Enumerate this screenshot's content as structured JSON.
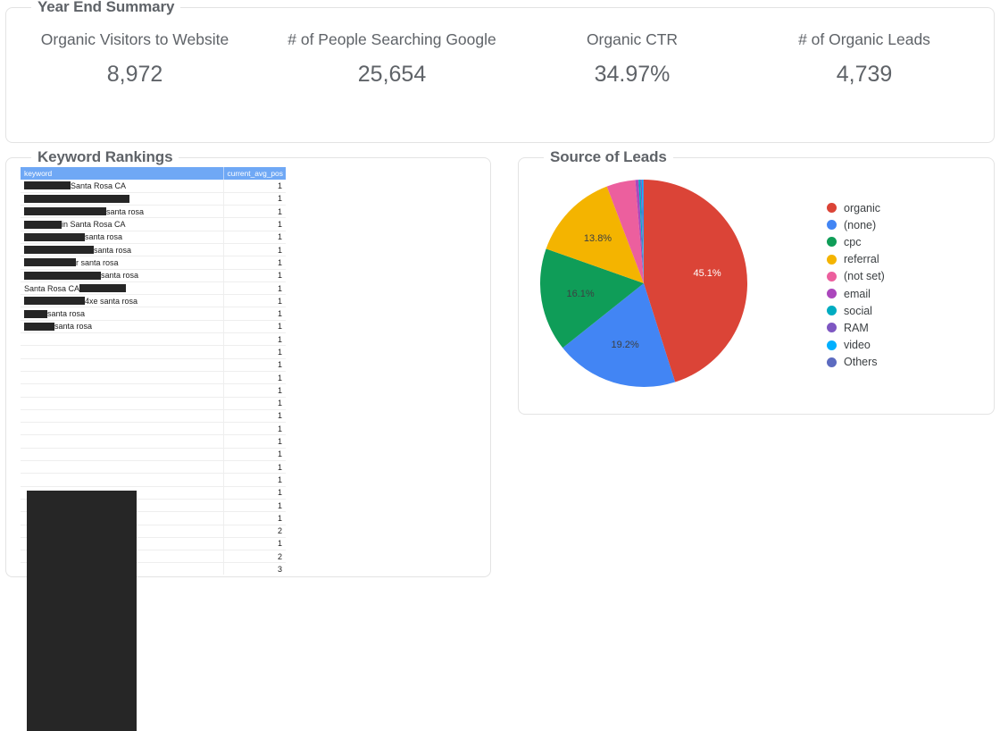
{
  "summary": {
    "title": "Year End Summary",
    "scorecards": [
      {
        "label": "Organic Visitors to Website",
        "value": "8,972"
      },
      {
        "label": "# of People Searching Google",
        "value": "25,654"
      },
      {
        "label": "Organic CTR",
        "value": "34.97%"
      },
      {
        "label": "# of Organic Leads",
        "value": "4,739"
      }
    ]
  },
  "keyword_rankings": {
    "title": "Keyword Rankings",
    "columns": [
      "keyword",
      "current_avg_pos"
    ],
    "rows": [
      {
        "keyword": "Santa Rosa CA",
        "redact_before": 52,
        "redact_after": 0,
        "current_avg_pos": "1"
      },
      {
        "keyword": "",
        "redact_before": 118,
        "redact_after": 0,
        "current_avg_pos": "1"
      },
      {
        "keyword": "santa rosa",
        "redact_before": 92,
        "redact_after": 0,
        "current_avg_pos": "1"
      },
      {
        "keyword": "in Santa Rosa CA",
        "redact_before": 42,
        "redact_after": 0,
        "current_avg_pos": "1"
      },
      {
        "keyword": " santa rosa",
        "redact_before": 68,
        "redact_after": 0,
        "current_avg_pos": "1"
      },
      {
        "keyword": " santa rosa",
        "redact_before": 78,
        "redact_after": 0,
        "current_avg_pos": "1"
      },
      {
        "keyword": "r santa rosa",
        "redact_before": 58,
        "redact_after": 0,
        "current_avg_pos": "1"
      },
      {
        "keyword": " santa rosa",
        "redact_before": 86,
        "redact_after": 0,
        "current_avg_pos": "1"
      },
      {
        "keyword": "Santa Rosa CA ",
        "redact_before": 0,
        "redact_after": 52,
        "current_avg_pos": "1"
      },
      {
        "keyword": "4xe santa rosa",
        "redact_before": 68,
        "redact_after": 0,
        "current_avg_pos": "1"
      },
      {
        "keyword": " santa rosa",
        "redact_before": 26,
        "redact_after": 0,
        "current_avg_pos": "1"
      },
      {
        "keyword": " santa rosa",
        "redact_before": 34,
        "redact_after": 0,
        "current_avg_pos": "1"
      },
      {
        "keyword": "",
        "redact_before": 0,
        "redact_after": 0,
        "current_avg_pos": "1"
      },
      {
        "keyword": "",
        "redact_before": 0,
        "redact_after": 0,
        "current_avg_pos": "1"
      },
      {
        "keyword": "",
        "redact_before": 0,
        "redact_after": 0,
        "current_avg_pos": "1"
      },
      {
        "keyword": "",
        "redact_before": 0,
        "redact_after": 0,
        "current_avg_pos": "1"
      },
      {
        "keyword": "",
        "redact_before": 0,
        "redact_after": 0,
        "current_avg_pos": "1"
      },
      {
        "keyword": "",
        "redact_before": 0,
        "redact_after": 0,
        "current_avg_pos": "1"
      },
      {
        "keyword": "",
        "redact_before": 0,
        "redact_after": 0,
        "current_avg_pos": "1"
      },
      {
        "keyword": "",
        "redact_before": 0,
        "redact_after": 0,
        "current_avg_pos": "1"
      },
      {
        "keyword": "",
        "redact_before": 0,
        "redact_after": 0,
        "current_avg_pos": "1"
      },
      {
        "keyword": "",
        "redact_before": 0,
        "redact_after": 0,
        "current_avg_pos": "1"
      },
      {
        "keyword": "",
        "redact_before": 0,
        "redact_after": 0,
        "current_avg_pos": "1"
      },
      {
        "keyword": "",
        "redact_before": 0,
        "redact_after": 0,
        "current_avg_pos": "1"
      },
      {
        "keyword": "",
        "redact_before": 0,
        "redact_after": 0,
        "current_avg_pos": "1"
      },
      {
        "keyword": "",
        "redact_before": 0,
        "redact_after": 0,
        "current_avg_pos": "1"
      },
      {
        "keyword": "",
        "redact_before": 0,
        "redact_after": 0,
        "current_avg_pos": "1"
      },
      {
        "keyword": "",
        "redact_before": 0,
        "redact_after": 0,
        "current_avg_pos": "2"
      },
      {
        "keyword": "",
        "redact_before": 0,
        "redact_after": 0,
        "current_avg_pos": "1"
      },
      {
        "keyword": "",
        "redact_before": 0,
        "redact_after": 0,
        "current_avg_pos": "2"
      },
      {
        "keyword": "",
        "redact_before": 0,
        "redact_after": 0,
        "current_avg_pos": "3"
      }
    ]
  },
  "source_of_leads": {
    "title": "Source of Leads"
  },
  "chart_data": {
    "type": "pie",
    "title": "Source of Leads",
    "legend_position": "right",
    "categories": [
      "organic",
      "(none)",
      "cpc",
      "referral",
      "(not set)",
      "email",
      "social",
      "RAM",
      "video",
      "Others"
    ],
    "values": [
      45.1,
      19.2,
      16.1,
      13.8,
      4.5,
      0.5,
      0.3,
      0.2,
      0.2,
      0.1
    ],
    "colors": [
      "#db4437",
      "#4285f4",
      "#0f9d58",
      "#f4b400",
      "#ec5f9e",
      "#ab47bc",
      "#00acc1",
      "#7e57c2",
      "#00b0ff",
      "#5c6bc0"
    ],
    "visible_labels": [
      "45.1%",
      "19.2%",
      "16.1%",
      "13.8%"
    ],
    "units": "percent"
  }
}
